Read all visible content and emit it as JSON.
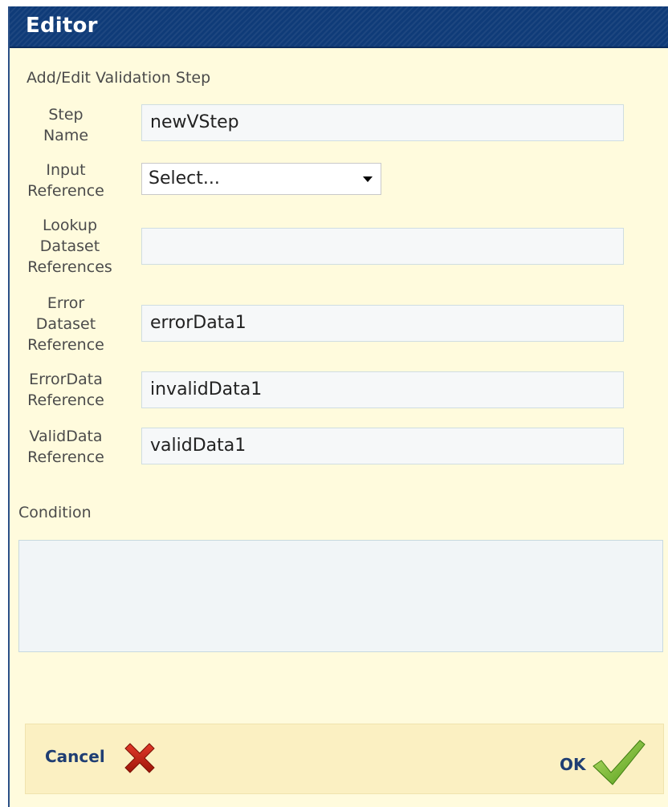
{
  "window": {
    "title": "Editor"
  },
  "form": {
    "subtitle": "Add/Edit Validation Step",
    "step_name": {
      "label": "Step\nName",
      "value": "newVStep"
    },
    "input_reference": {
      "label": "Input\nReference",
      "selected": "Select..."
    },
    "lookup_dataset": {
      "label": "Lookup\nDataset\nReferences",
      "value": ""
    },
    "error_dataset": {
      "label": "Error\nDataset\nReference",
      "value": "errorData1"
    },
    "errordata_ref": {
      "label": "ErrorData\nReference",
      "value": "invalidData1"
    },
    "validdata_ref": {
      "label": "ValidData\nReference",
      "value": "validData1"
    },
    "condition": {
      "label": "Condition",
      "value": ""
    }
  },
  "footer": {
    "cancel_label": "Cancel",
    "ok_label": "OK",
    "cancel_icon": "red-x-icon",
    "ok_icon": "green-check-icon"
  },
  "colors": {
    "titlebar": "#0f3b78",
    "dialog_bg": "#fffbdd",
    "footer_bg": "#fbf0c2",
    "field_bg": "#f6f8f9"
  }
}
